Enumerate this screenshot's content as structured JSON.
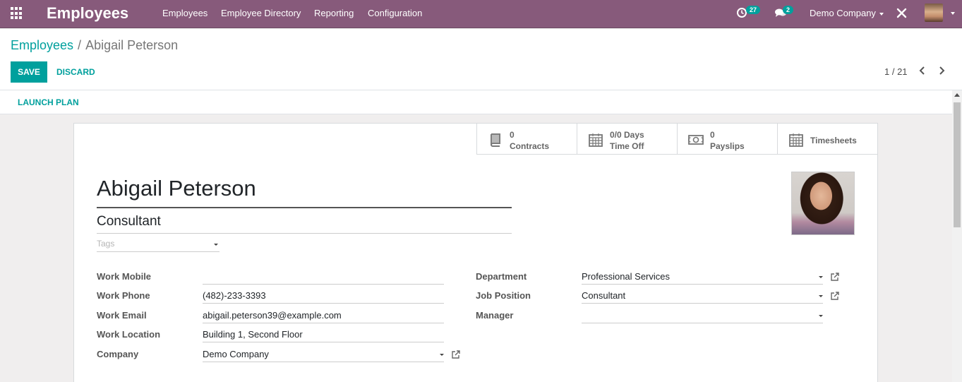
{
  "navbar": {
    "app_title": "Employees",
    "menu": [
      "Employees",
      "Employee Directory",
      "Reporting",
      "Configuration"
    ],
    "activity_count": "27",
    "message_count": "2",
    "company": "Demo Company"
  },
  "breadcrumb": {
    "parent": "Employees",
    "separator": "/",
    "current": "Abigail Peterson"
  },
  "actions": {
    "save": "SAVE",
    "discard": "DISCARD",
    "launch_plan": "LAUNCH PLAN"
  },
  "pager": {
    "value": "1 / 21"
  },
  "smart_buttons": {
    "contracts": {
      "value": "0",
      "label": "Contracts",
      "icon": "book-icon"
    },
    "time_off": {
      "value": "0/0 Days",
      "label": "Time Off",
      "icon": "calendar-icon"
    },
    "payslips": {
      "value": "0",
      "label": "Payslips",
      "icon": "money-icon"
    },
    "timesheets": {
      "label": "Timesheets",
      "icon": "calendar-icon"
    }
  },
  "employee": {
    "name": "Abigail Peterson",
    "job_title": "Consultant",
    "tags_placeholder": "Tags"
  },
  "fields_left": {
    "work_mobile": {
      "label": "Work Mobile",
      "value": ""
    },
    "work_phone": {
      "label": "Work Phone",
      "value": "(482)-233-3393"
    },
    "work_email": {
      "label": "Work Email",
      "value": "abigail.peterson39@example.com"
    },
    "work_location": {
      "label": "Work Location",
      "value": "Building 1, Second Floor"
    },
    "company": {
      "label": "Company",
      "value": "Demo Company"
    }
  },
  "fields_right": {
    "department": {
      "label": "Department",
      "value": "Professional Services"
    },
    "job_position": {
      "label": "Job Position",
      "value": "Consultant"
    },
    "manager": {
      "label": "Manager",
      "value": ""
    }
  },
  "colors": {
    "navbar": "#875a7b",
    "accent": "#00a09d"
  }
}
